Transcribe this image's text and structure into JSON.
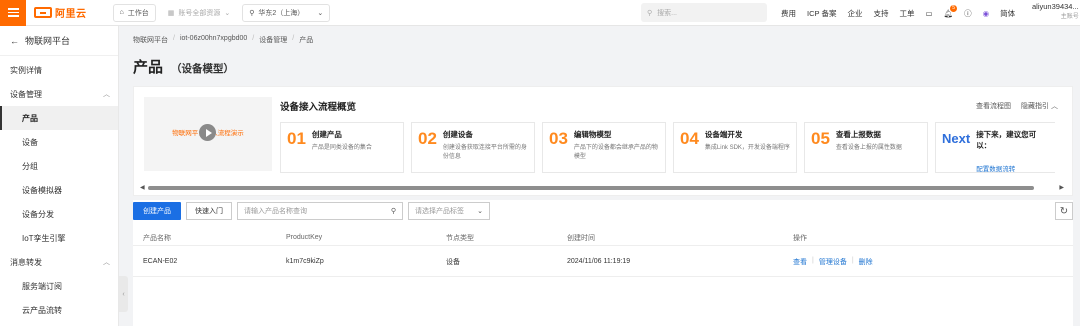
{
  "topbar": {
    "logo_text": "阿里云",
    "workbench": "工作台",
    "account": "账号全部资源",
    "region": "华东2（上海）",
    "search_placeholder": "搜索...",
    "links": [
      "费用",
      "ICP 备案",
      "企业",
      "支持",
      "工单"
    ],
    "badge_count": "5",
    "lang": "简体",
    "user_name": "aliyun39434...",
    "user_role": "主账号"
  },
  "sidebar": {
    "back_label": "物联网平台",
    "items": [
      {
        "label": "实例详情"
      },
      {
        "label": "设备管理"
      },
      {
        "label": "产品"
      },
      {
        "label": "设备"
      },
      {
        "label": "分组"
      },
      {
        "label": "设备模拟器"
      },
      {
        "label": "设备分发"
      },
      {
        "label": "IoT孪生引擎"
      },
      {
        "label": "消息转发"
      },
      {
        "label": "服务端订阅"
      },
      {
        "label": "云产品流转"
      }
    ]
  },
  "breadcrumb": [
    "物联网平台",
    "iot-06z00hn7xpgbd00",
    "设备管理",
    "产品"
  ],
  "page": {
    "title": "产品",
    "subtitle": "（设备模型）"
  },
  "flow": {
    "video_text": "物联网平台接入流程演示",
    "title": "设备接入流程概览",
    "view_flow": "查看流程图",
    "hide_guide": "隐藏指引",
    "steps": [
      {
        "num": "01",
        "name": "创建产品",
        "desc": "产品是同类设备的集合"
      },
      {
        "num": "02",
        "name": "创建设备",
        "desc": "创建设备获取连接平台所需的身份信息"
      },
      {
        "num": "03",
        "name": "编辑物模型",
        "desc": "产品下的设备都会继承产品的物模型"
      },
      {
        "num": "04",
        "name": "设备端开发",
        "desc": "集成Link SDK，开发设备端程序"
      },
      {
        "num": "05",
        "name": "查看上报数据",
        "desc": "查看设备上报的属性数据"
      }
    ],
    "next": {
      "num": "Next",
      "name": "接下来，建议您可以：",
      "link": "配置数据流转"
    }
  },
  "toolbar": {
    "create": "创建产品",
    "quick": "快速入门",
    "search_placeholder": "请输入产品名称查询",
    "tag_placeholder": "请选择产品标签"
  },
  "table": {
    "headers": [
      "产品名称",
      "ProductKey",
      "节点类型",
      "创建时间",
      "操作"
    ],
    "rows": [
      {
        "name": "ECAN-E02",
        "key": "k1m7c9kiZp",
        "node": "设备",
        "time": "2024/11/06 11:19:19",
        "op_view": "查看",
        "op_manage": "管理设备",
        "op_delete": "删除"
      }
    ]
  }
}
